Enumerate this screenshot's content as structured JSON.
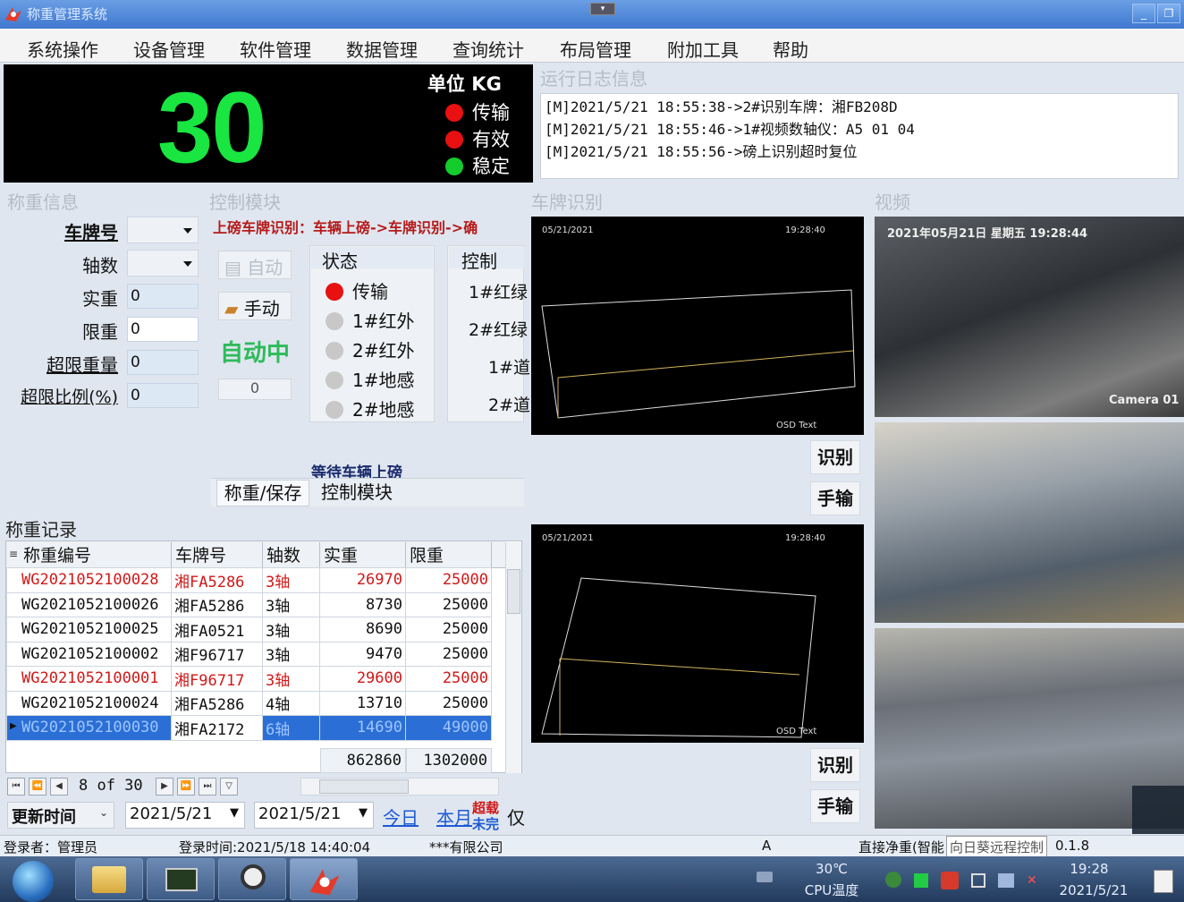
{
  "window": {
    "title": "称重管理系统"
  },
  "menu": [
    "系统操作",
    "设备管理",
    "软件管理",
    "数据管理",
    "查询统计",
    "布局管理",
    "附加工具",
    "帮助"
  ],
  "display": {
    "weight": "30",
    "unit_label": "单位 KG",
    "indicators": [
      {
        "label": "传输",
        "color": "#e81010"
      },
      {
        "label": "有效",
        "color": "#e81010"
      },
      {
        "label": "稳定",
        "color": "#14cc2c"
      }
    ]
  },
  "log": {
    "title": "运行日志信息",
    "lines": [
      "[M]2021/5/21 18:55:38->2#识别车牌：湘FB208D",
      "[M]2021/5/21 18:55:46->1#视频数轴仪：A5 01 04",
      "[M]2021/5/21 18:55:56->磅上识别超时复位"
    ]
  },
  "weigh_info": {
    "title": "称重信息",
    "plate_label": "车牌号",
    "axle_label": "轴数",
    "actual_label": "实重",
    "actual_value": "0",
    "limit_label": "限重",
    "limit_value": "0",
    "over_weight_label": "超限重量",
    "over_weight_value": "0",
    "over_ratio_label": "超限比例(%)",
    "over_ratio_value": "0"
  },
  "control": {
    "title": "控制模块",
    "flow_text": "上磅车牌识别：车辆上磅->车牌识别->确",
    "auto_button": "自动",
    "manual_button": "手动",
    "mode_text": "自动中",
    "counter": "0",
    "status_header": "状态",
    "status_items": [
      {
        "label": "传输",
        "color": "#e81010"
      },
      {
        "label": "1#红外",
        "color": "#c8c8c8"
      },
      {
        "label": "2#红外",
        "color": "#c8c8c8"
      },
      {
        "label": "1#地感",
        "color": "#c8c8c8"
      },
      {
        "label": "2#地感",
        "color": "#c8c8c8"
      }
    ],
    "control_header": "控制",
    "control_items": [
      "1#红绿",
      "2#红绿",
      "1#道",
      "2#道"
    ],
    "waiting_text": "等待车辆上磅",
    "tabs": [
      "称重/保存",
      "控制模块"
    ]
  },
  "plate_recognition": {
    "title": "车牌识别",
    "cams": [
      {
        "date": "05/21/2021",
        "time": "19:28:40",
        "osd": "OSD Text",
        "recognize": "识别",
        "manual": "手输"
      },
      {
        "date": "05/21/2021",
        "time": "19:28:40",
        "osd": "OSD Text",
        "recognize": "识别",
        "manual": "手输"
      }
    ]
  },
  "video": {
    "title": "视频",
    "cam1_overlay": "2021年05月21日 星期五 19:28:44",
    "cam1_label": "Camera 01"
  },
  "records": {
    "title": "称重记录",
    "columns": [
      "称重编号",
      "车牌号",
      "轴数",
      "实重",
      "限重"
    ],
    "rows": [
      {
        "id": "WG2021052100028",
        "plate": "湘FA5286",
        "axles": "3轴",
        "actual": "26970",
        "limit": "25000",
        "over": true
      },
      {
        "id": "WG2021052100026",
        "plate": "湘FA5286",
        "axles": "3轴",
        "actual": "8730",
        "limit": "25000",
        "over": false
      },
      {
        "id": "WG2021052100025",
        "plate": "湘FA0521",
        "axles": "3轴",
        "actual": "8690",
        "limit": "25000",
        "over": false
      },
      {
        "id": "WG2021052100002",
        "plate": "湘F96717",
        "axles": "3轴",
        "actual": "9470",
        "limit": "25000",
        "over": false
      },
      {
        "id": "WG2021052100001",
        "plate": "湘F96717",
        "axles": "3轴",
        "actual": "29600",
        "limit": "25000",
        "over": true
      },
      {
        "id": "WG2021052100024",
        "plate": "湘FA5286",
        "axles": "4轴",
        "actual": "13710",
        "limit": "25000",
        "over": false
      },
      {
        "id": "WG2021052100030",
        "plate": "湘FA2172",
        "axles": "6轴",
        "actual": "14690",
        "limit": "49000",
        "over": false
      }
    ],
    "total_actual": "862860",
    "total_limit": "1302000",
    "pager": "8 of 30"
  },
  "filter": {
    "field": "更新时间",
    "from": "2021/5/21",
    "to": "2021/5/21",
    "today": "今日",
    "month": "本月",
    "overload": "超载",
    "incomplete": "未完",
    "only": "仅"
  },
  "statusbar": {
    "user": "登录者：管理员",
    "login_time": "登录时间:2021/5/18 14:40:04",
    "company": "***有限公司",
    "a": "A",
    "net": "直接净重(智能",
    "remote": "向日葵远程控制",
    "version": "0.1.8"
  },
  "taskbar": {
    "temp": "30℃",
    "cpu": "CPU温度",
    "time": "19:28",
    "date": "2021/5/21"
  }
}
